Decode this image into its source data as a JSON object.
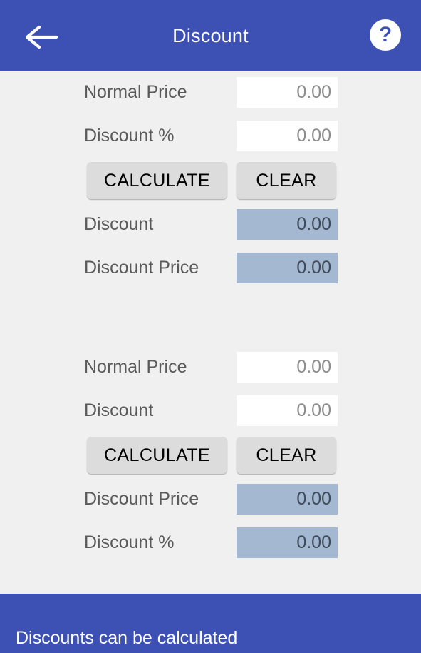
{
  "appbar": {
    "back_icon": "arrow-left-icon",
    "title": "Discount",
    "help_icon": "help-question-icon",
    "help_glyph": "?",
    "background": "#3d51b5"
  },
  "colors": {
    "primary": "#3d51b5",
    "page_background": "#eff0ef",
    "input_background": "#ffffff",
    "result_background": "#a5b8d2",
    "button_background": "#dcdcdc",
    "label_text": "#5a5a5a",
    "input_text": "#8d8d8d",
    "result_text": "#3f4b59"
  },
  "sections": [
    {
      "id": "discount-by-percent",
      "inputs": [
        {
          "label": "Normal Price",
          "value": "0.00",
          "placeholder": "0.00"
        },
        {
          "label": "Discount %",
          "value": "0.00",
          "placeholder": "0.00"
        }
      ],
      "buttons": {
        "calculate": "CALCULATE",
        "clear": "CLEAR"
      },
      "results": [
        {
          "label": "Discount",
          "value": "0.00"
        },
        {
          "label": "Discount Price",
          "value": "0.00"
        }
      ]
    },
    {
      "id": "discount-by-amount",
      "inputs": [
        {
          "label": "Normal Price",
          "value": "0.00",
          "placeholder": "0.00"
        },
        {
          "label": "Discount",
          "value": "0.00",
          "placeholder": "0.00"
        }
      ],
      "buttons": {
        "calculate": "CALCULATE",
        "clear": "CLEAR"
      },
      "results": [
        {
          "label": "Discount Price",
          "value": "0.00"
        },
        {
          "label": "Discount %",
          "value": "0.00"
        }
      ]
    }
  ],
  "bottom_banner": {
    "text": "Discounts can be calculated"
  }
}
